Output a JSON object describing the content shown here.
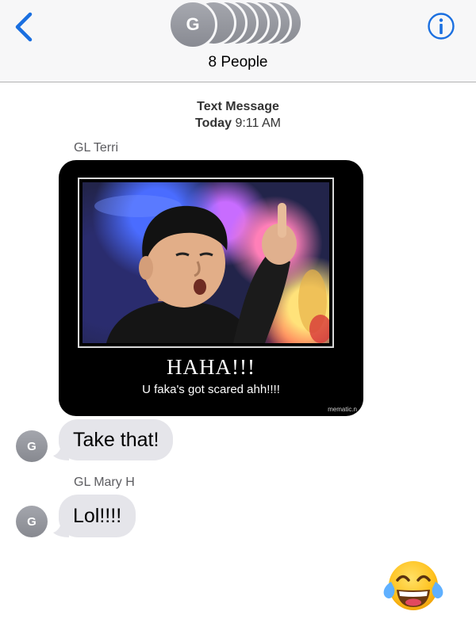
{
  "header": {
    "back_label": "Back",
    "info_label": "Details",
    "avatar_initial": "G",
    "group_name": "8 People"
  },
  "conversation": {
    "service": "Text Message",
    "day": "Today",
    "time": "9:11 AM"
  },
  "messages": [
    {
      "sender": "GL Terri",
      "type": "image",
      "meme_title": "HAHA!!!",
      "meme_caption": "U faka's got scared ahh!!!!",
      "watermark": "mematic.n"
    },
    {
      "sender_initial": "G",
      "type": "text",
      "text": "Take that!"
    },
    {
      "sender": "GL Mary H",
      "sender_initial": "G",
      "type": "text",
      "text": "Lol!!!!"
    },
    {
      "type": "emoji",
      "emoji": "face-with-tears-of-joy"
    }
  ],
  "colors": {
    "accent": "#1a73e8",
    "header_bg": "#f7f7f8",
    "incoming_bubble": "#e5e5ea",
    "avatar_gray": "#9a9ca3"
  },
  "icons": {
    "back": "chevron-left-icon",
    "info": "info-icon"
  }
}
